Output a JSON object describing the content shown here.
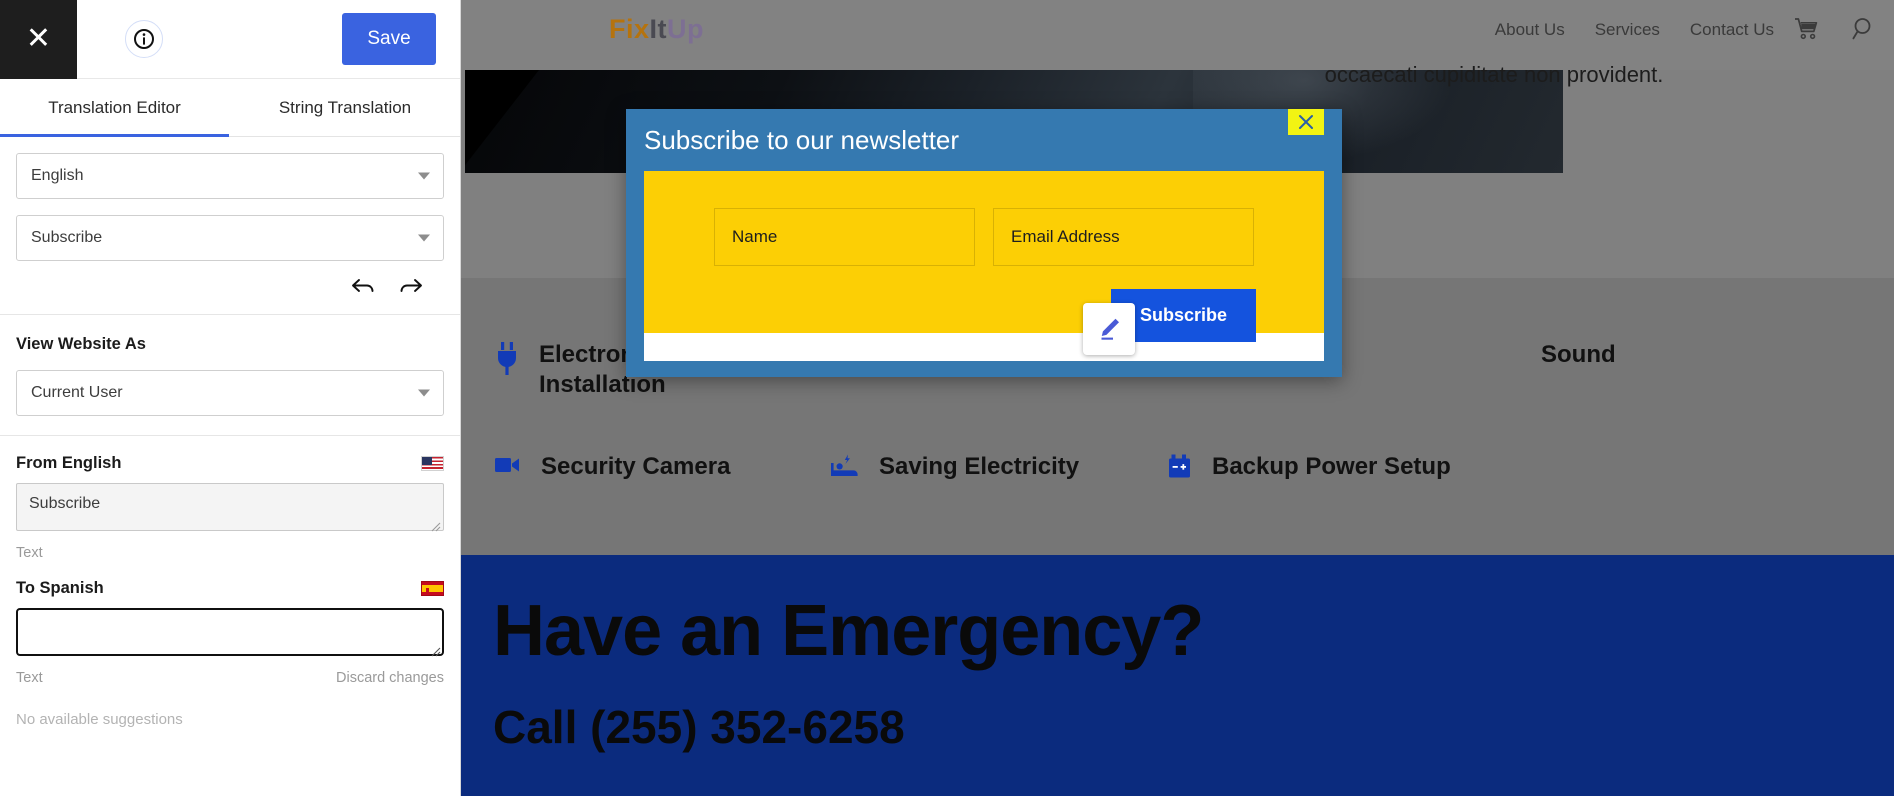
{
  "panel": {
    "close_icon": "close-icon",
    "info_icon": "info-icon",
    "save_label": "Save",
    "tabs": [
      {
        "label": "Translation Editor",
        "active": true
      },
      {
        "label": "String Translation",
        "active": false
      }
    ],
    "language_select": {
      "value": "English",
      "caret": "chevron-down-icon"
    },
    "string_select": {
      "value": "Subscribe",
      "caret": "chevron-down-icon"
    },
    "undo_icon": "undo-arrow-icon",
    "redo_icon": "redo-arrow-icon",
    "view_website_as": {
      "label": "View Website As",
      "value": "Current User"
    },
    "from": {
      "label": "From English",
      "flag": "us-flag-icon",
      "value": "Subscribe",
      "meta": "Text"
    },
    "to": {
      "label": "To Spanish",
      "flag": "spain-flag-icon",
      "value": "",
      "placeholder": "",
      "meta": "Text",
      "discard_label": "Discard changes"
    },
    "suggestions_empty": "No available suggestions"
  },
  "site": {
    "logo": {
      "part1": "Fix",
      "part2": "It",
      "part3": "Up"
    },
    "nav": [
      {
        "label": "About Us"
      },
      {
        "label": "Services"
      },
      {
        "label": "Contact Us"
      }
    ],
    "nav_icons": [
      {
        "name": "cart-icon"
      },
      {
        "name": "search-icon"
      }
    ],
    "lorem_text": "occaecati cupiditate non provident.",
    "services": [
      {
        "label": "Electronic\nInstallation",
        "icon": "plug-icon"
      },
      {
        "label": "",
        "icon": ""
      },
      {
        "label": "Sound",
        "icon": ""
      },
      {
        "label": "Security Camera",
        "icon": "video-camera-icon"
      },
      {
        "label": "Saving Electricity",
        "icon": "energy-saving-bed-icon"
      },
      {
        "label": "Backup Power Setup",
        "icon": "battery-icon"
      }
    ],
    "emergency": {
      "title": "Have an Emergency?",
      "call": "Call (255) 352-6258"
    }
  },
  "modal": {
    "title": "Subscribe to our newsletter",
    "close_icon": "close-icon",
    "name_field": {
      "placeholder": "Name",
      "value": ""
    },
    "email_field": {
      "placeholder": "Email Address",
      "value": ""
    },
    "submit_label": "Subscribe",
    "edit_badge_icon": "pencil-edit-icon"
  },
  "colors": {
    "accent_blue": "#3a63e0",
    "modal_blue": "#3579b0",
    "modal_yellow": "#fccf05",
    "submit_blue": "#1453de",
    "close_yellow": "#f2f413",
    "emergency_navy": "#0b2b7e",
    "brand_orange": "#b5730e",
    "brand_purple": "#7d6f93"
  }
}
